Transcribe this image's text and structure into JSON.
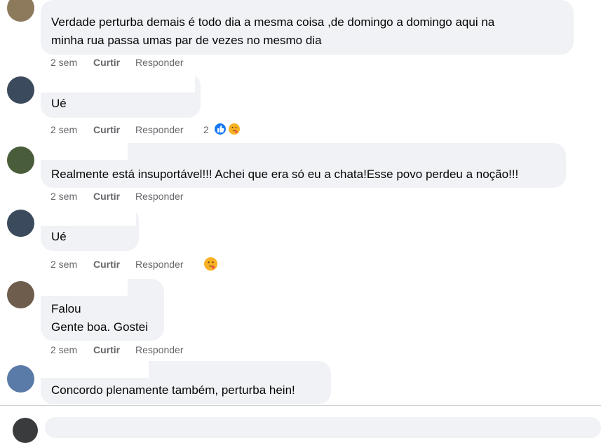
{
  "comments": [
    {
      "text_lines": [
        "Verdade perturba demais é todo dia a mesma coisa ,de domingo a domingo aqui na",
        "minha rua passa umas par de vezes no mesmo dia"
      ],
      "time": "2 sem",
      "like_label": "Curtir",
      "reply_label": "Responder"
    },
    {
      "text_lines": [
        "Ué"
      ],
      "time": "2 sem",
      "like_label": "Curtir",
      "reply_label": "Responder",
      "reaction_count": "2",
      "reactions": [
        "like-icon",
        "care-icon"
      ]
    },
    {
      "text_lines": [
        "Realmente está insuportável!!! Achei que era só eu a chata!Esse povo perdeu a noção!!!"
      ],
      "time": "2 sem",
      "like_label": "Curtir",
      "reply_label": "Responder"
    },
    {
      "text_lines": [
        "Ué"
      ],
      "time": "2 sem",
      "like_label": "Curtir",
      "reply_label": "Responder",
      "reactions": [
        "care-icon"
      ]
    },
    {
      "text_lines": [
        "Falou",
        "Gente boa. Gostei"
      ],
      "time": "2 sem",
      "like_label": "Curtir",
      "reply_label": "Responder"
    },
    {
      "text_lines": [
        "Concordo plenamente também, perturba hein!"
      ]
    }
  ],
  "colors": {
    "bubble": "#f0f2f5",
    "meta_text": "#65676b",
    "like_blue": "#1877f2",
    "care_yellow": "#f7b125"
  }
}
